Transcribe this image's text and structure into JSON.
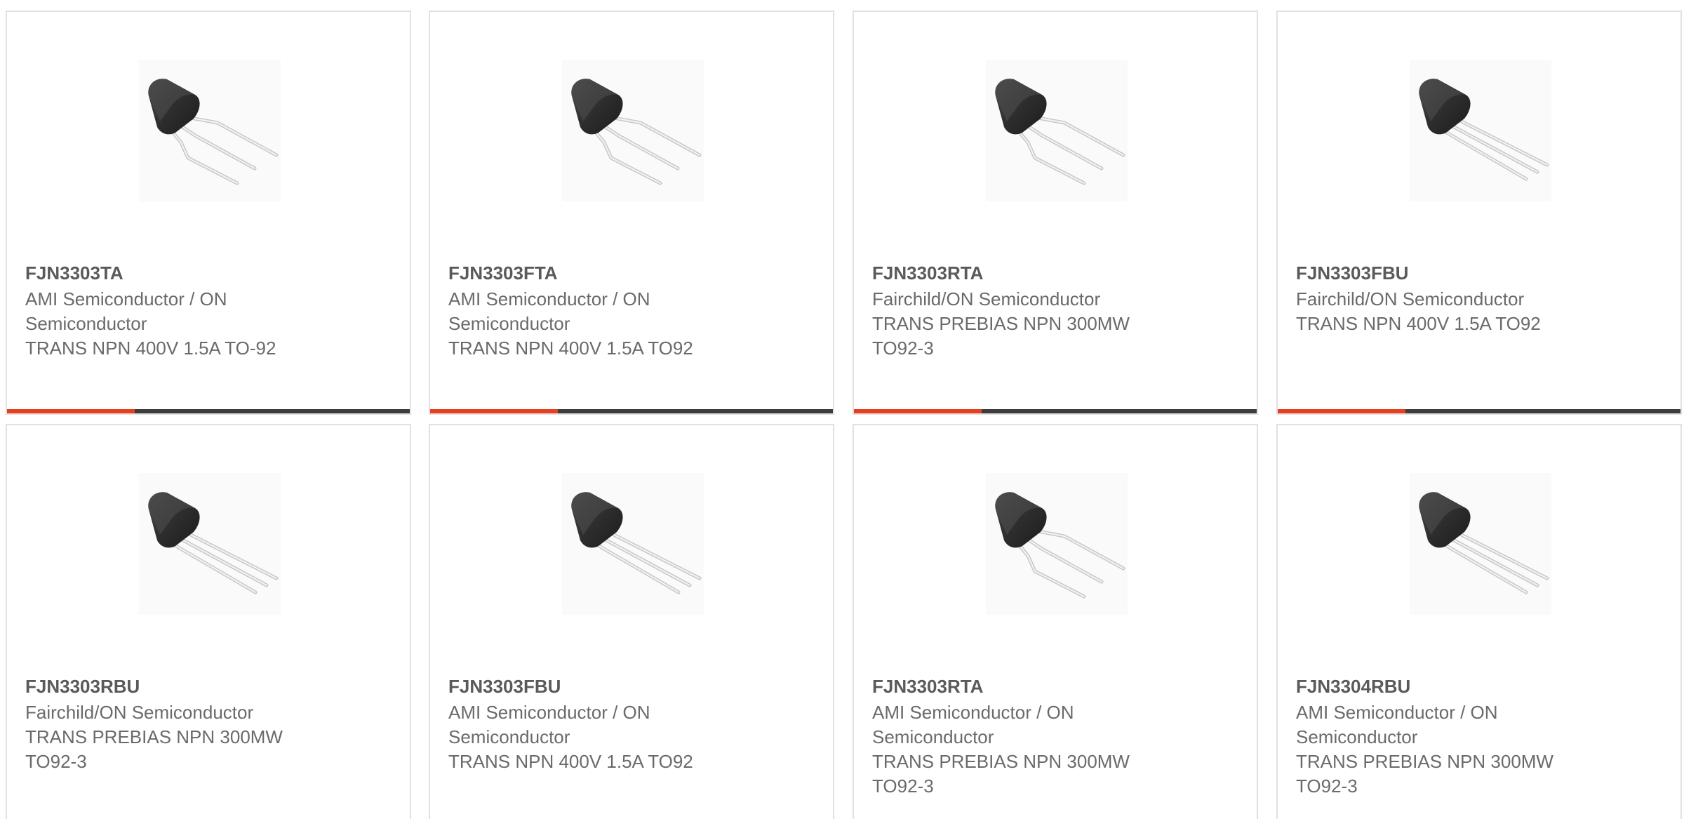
{
  "colors": {
    "accent": "#e8401f",
    "bar": "#3d3d3d",
    "border": "#e1e1e1",
    "text": "#6a6a6a"
  },
  "products": [
    {
      "part_number": "FJN3303TA",
      "manufacturer": "AMI Semiconductor / ON\nSemiconductor",
      "description": "TRANS NPN 400V 1.5A TO-92",
      "image": "to92-transistor-bent-leads"
    },
    {
      "part_number": "FJN3303FTA",
      "manufacturer": "AMI Semiconductor / ON\nSemiconductor",
      "description": "TRANS NPN 400V 1.5A TO92",
      "image": "to92-transistor-bent-leads"
    },
    {
      "part_number": "FJN3303RTA",
      "manufacturer": "Fairchild/ON Semiconductor",
      "description": "TRANS PREBIAS NPN 300MW\nTO92-3",
      "image": "to92-transistor-bent-leads"
    },
    {
      "part_number": "FJN3303FBU",
      "manufacturer": "Fairchild/ON Semiconductor",
      "description": "TRANS NPN 400V 1.5A TO92",
      "image": "to92-transistor-straight-leads"
    },
    {
      "part_number": "FJN3303RBU",
      "manufacturer": "Fairchild/ON Semiconductor",
      "description": "TRANS PREBIAS NPN 300MW\nTO92-3",
      "image": "to92-transistor-straight-leads"
    },
    {
      "part_number": "FJN3303FBU",
      "manufacturer": "AMI Semiconductor / ON\nSemiconductor",
      "description": "TRANS NPN 400V 1.5A TO92",
      "image": "to92-transistor-straight-leads"
    },
    {
      "part_number": "FJN3303RTA",
      "manufacturer": "AMI Semiconductor / ON\nSemiconductor",
      "description": "TRANS PREBIAS NPN 300MW\nTO92-3",
      "image": "to92-transistor-bent-leads"
    },
    {
      "part_number": "FJN3304RBU",
      "manufacturer": "AMI Semiconductor / ON\nSemiconductor",
      "description": "TRANS PREBIAS NPN 300MW\nTO92-3",
      "image": "to92-transistor-straight-leads"
    }
  ]
}
